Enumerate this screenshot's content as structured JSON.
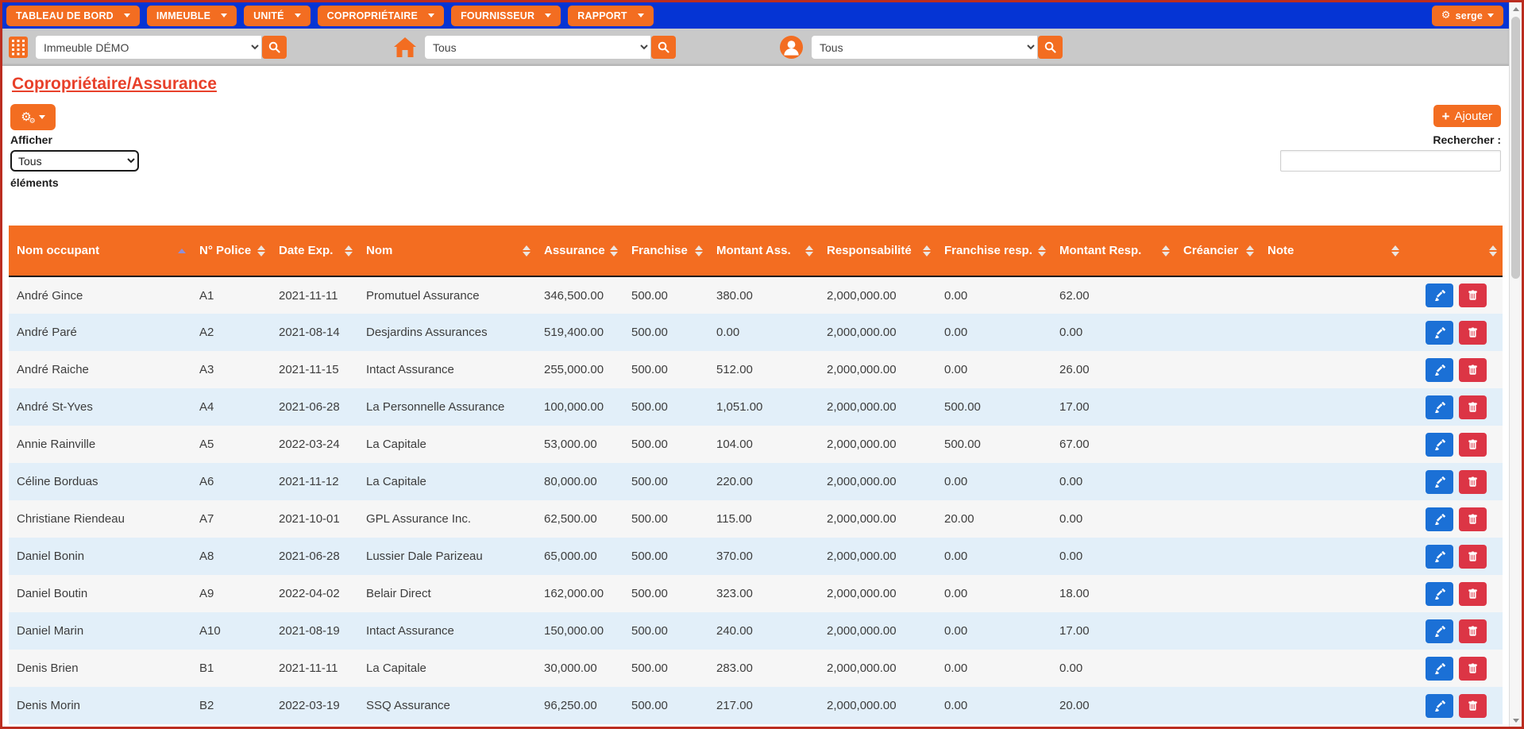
{
  "nav": {
    "items": [
      {
        "label": "TABLEAU DE BORD"
      },
      {
        "label": "IMMEUBLE"
      },
      {
        "label": "UNITÉ"
      },
      {
        "label": "COPROPRIÉTAIRE"
      },
      {
        "label": "FOURNISSEUR"
      },
      {
        "label": "RAPPORT"
      }
    ],
    "user_label": "serge"
  },
  "toolbar": {
    "building_select_value": "Immeuble DÉMO",
    "unit_select_value": "Tous",
    "owner_select_value": "Tous"
  },
  "page": {
    "title": "Copropriétaire/Assurance",
    "add_button_label": "Ajouter",
    "length_label_before": "Afficher",
    "length_select_value": "Tous",
    "length_label_after": "éléments",
    "search_label": "Rechercher :",
    "search_value": ""
  },
  "table": {
    "columns": [
      "Nom occupant",
      "N° Police",
      "Date Exp.",
      "Nom",
      "Assurance",
      "Franchise",
      "Montant Ass.",
      "Responsabilité",
      "Franchise resp.",
      "Montant Resp.",
      "Créancier",
      "Note"
    ],
    "sorted_column": "Nom occupant",
    "sort_direction": "asc",
    "rows": [
      [
        "André Gince",
        "A1",
        "2021-11-11",
        "Promutuel Assurance",
        "346,500.00",
        "500.00",
        "380.00",
        "2,000,000.00",
        "0.00",
        "62.00",
        "",
        ""
      ],
      [
        "André Paré",
        "A2",
        "2021-08-14",
        "Desjardins Assurances",
        "519,400.00",
        "500.00",
        "0.00",
        "2,000,000.00",
        "0.00",
        "0.00",
        "",
        ""
      ],
      [
        "André Raiche",
        "A3",
        "2021-11-15",
        "Intact Assurance",
        "255,000.00",
        "500.00",
        "512.00",
        "2,000,000.00",
        "0.00",
        "26.00",
        "",
        ""
      ],
      [
        "André St-Yves",
        "A4",
        "2021-06-28",
        "La Personnelle Assurance",
        "100,000.00",
        "500.00",
        "1,051.00",
        "2,000,000.00",
        "500.00",
        "17.00",
        "",
        ""
      ],
      [
        "Annie Rainville",
        "A5",
        "2022-03-24",
        "La Capitale",
        "53,000.00",
        "500.00",
        "104.00",
        "2,000,000.00",
        "500.00",
        "67.00",
        "",
        ""
      ],
      [
        "Céline Borduas",
        "A6",
        "2021-11-12",
        "La Capitale",
        "80,000.00",
        "500.00",
        "220.00",
        "2,000,000.00",
        "0.00",
        "0.00",
        "",
        ""
      ],
      [
        "Christiane Riendeau",
        "A7",
        "2021-10-01",
        "GPL Assurance Inc.",
        "62,500.00",
        "500.00",
        "115.00",
        "2,000,000.00",
        "20.00",
        "0.00",
        "",
        ""
      ],
      [
        "Daniel Bonin",
        "A8",
        "2021-06-28",
        "Lussier Dale Parizeau",
        "65,000.00",
        "500.00",
        "370.00",
        "2,000,000.00",
        "0.00",
        "0.00",
        "",
        ""
      ],
      [
        "Daniel Boutin",
        "A9",
        "2022-04-02",
        "Belair Direct",
        "162,000.00",
        "500.00",
        "323.00",
        "2,000,000.00",
        "0.00",
        "18.00",
        "",
        ""
      ],
      [
        "Daniel Marin",
        "A10",
        "2021-08-19",
        "Intact Assurance",
        "150,000.00",
        "500.00",
        "240.00",
        "2,000,000.00",
        "0.00",
        "17.00",
        "",
        ""
      ],
      [
        "Denis Brien",
        "B1",
        "2021-11-11",
        "La Capitale",
        "30,000.00",
        "500.00",
        "283.00",
        "2,000,000.00",
        "0.00",
        "0.00",
        "",
        ""
      ],
      [
        "Denis Morin",
        "B2",
        "2022-03-19",
        "SSQ Assurance",
        "96,250.00",
        "500.00",
        "217.00",
        "2,000,000.00",
        "0.00",
        "20.00",
        "",
        ""
      ]
    ]
  },
  "colors": {
    "accent_orange": "#f36d21",
    "nav_blue": "#0534d4",
    "title_red": "#e8402a",
    "edit_blue": "#1b70d6",
    "delete_red": "#dc3545",
    "row_alt_blue": "#e2eff9",
    "toolbar_gray": "#c9c9c9",
    "window_border_red": "#bb2d20"
  }
}
